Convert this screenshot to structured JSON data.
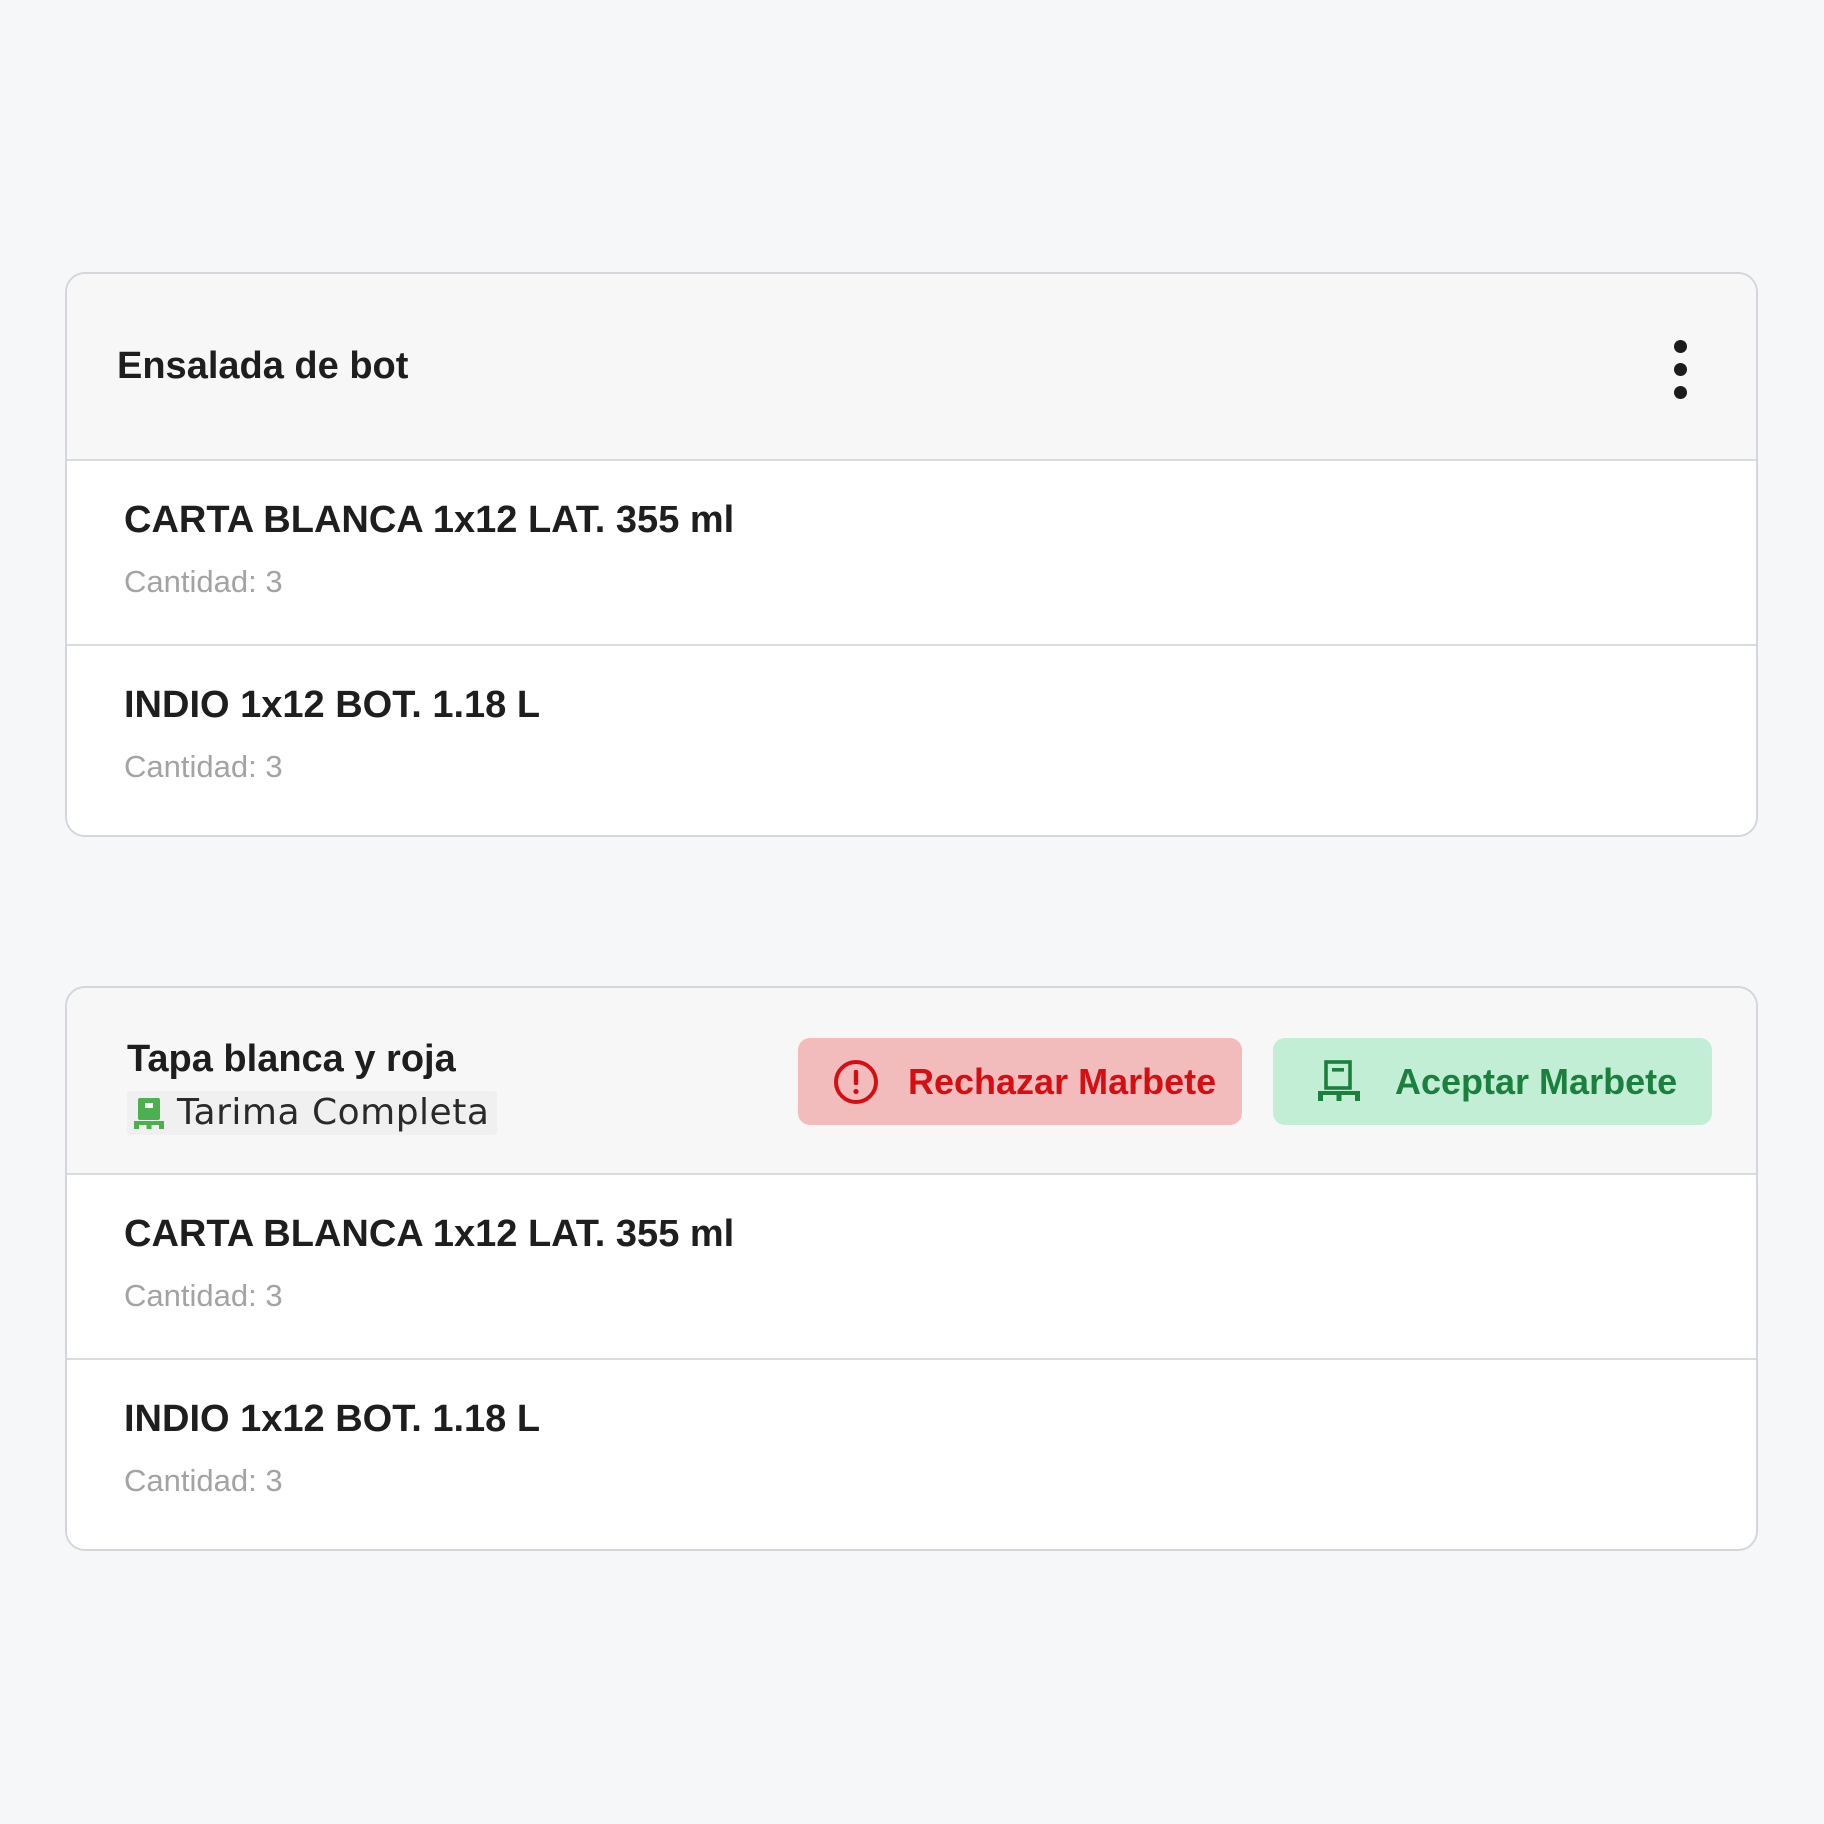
{
  "colors": {
    "page_background": "#f6f7f8",
    "reject_bg": "#f2bcbd",
    "reject_text": "#d40f14",
    "accept_bg": "#c3eed6",
    "accept_text": "#1b7f3d",
    "pallet_icon": "#4caf50"
  },
  "card1": {
    "title": "Ensalada de bot",
    "menu_icon": "more-vertical-icon",
    "items": [
      {
        "name": "CARTA BLANCA 1x12 LAT. 355 ml",
        "quantity": "Cantidad: 3"
      },
      {
        "name": "INDIO 1x12 BOT. 1.18 L",
        "quantity": "Cantidad: 3"
      }
    ]
  },
  "card2": {
    "title": "Tapa blanca y roja",
    "badge": {
      "icon": "pallet-icon",
      "label": "Tarima Completa"
    },
    "reject_button": {
      "icon": "alert-circle-icon",
      "label": "Rechazar Marbete"
    },
    "accept_button": {
      "icon": "pallet-icon",
      "label": "Aceptar Marbete"
    },
    "items": [
      {
        "name": "CARTA BLANCA 1x12 LAT. 355 ml",
        "quantity": "Cantidad: 3"
      },
      {
        "name": "INDIO 1x12 BOT. 1.18 L",
        "quantity": "Cantidad: 3"
      }
    ]
  }
}
